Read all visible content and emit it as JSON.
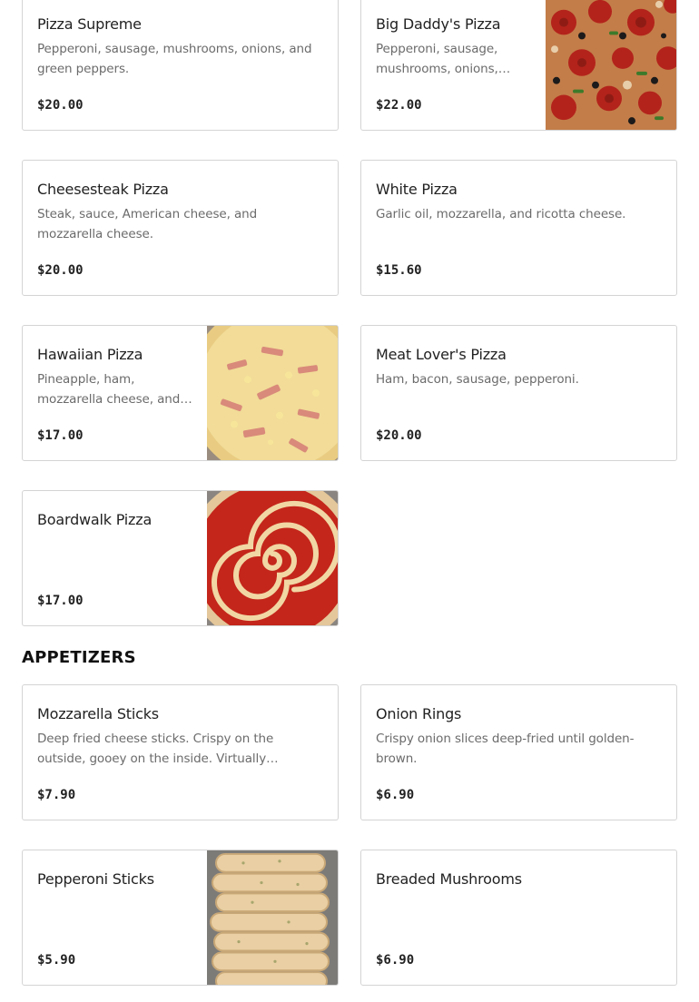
{
  "pizza_items": [
    {
      "name": "Pizza Supreme",
      "description": "Pepperoni, sausage, mushrooms, onions, and green peppers.",
      "price": "$20.00",
      "image": null
    },
    {
      "name": "Big Daddy's Pizza",
      "description": "Pepperoni, sausage, mushrooms, onions, green peppers, black olives, and ham.",
      "price": "$22.00",
      "image": "big-daddys-pizza-photo"
    },
    {
      "name": "Cheesesteak Pizza",
      "description": "Steak, sauce, American cheese, and mozzarella cheese.",
      "price": "$20.00",
      "image": null
    },
    {
      "name": "White Pizza",
      "description": "Garlic oil, mozzarella, and ricotta cheese.",
      "price": "$15.60",
      "image": null
    },
    {
      "name": "Hawaiian Pizza",
      "description": "Pineapple, ham, mozzarella cheese, and sauce.",
      "price": "$17.00",
      "image": "hawaiian-pizza-photo"
    },
    {
      "name": "Meat Lover's Pizza",
      "description": "Ham, bacon, sausage, pepperoni.",
      "price": "$20.00",
      "image": null
    },
    {
      "name": "Boardwalk Pizza",
      "description": "",
      "price": "$17.00",
      "image": "boardwalk-pizza-photo"
    }
  ],
  "appetizers": {
    "title": "APPETIZERS",
    "items": [
      {
        "name": "Mozzarella Sticks",
        "description": "Deep fried cheese sticks. Crispy on the outside, gooey on the inside. Virtually guaranteed to be a hit.",
        "price": "$7.90",
        "image": null
      },
      {
        "name": "Onion Rings",
        "description": "Crispy onion slices deep-fried until golden-brown.",
        "price": "$6.90",
        "image": null
      },
      {
        "name": "Pepperoni Sticks",
        "description": "",
        "price": "$5.90",
        "image": "pepperoni-sticks-photo"
      },
      {
        "name": "Breaded Mushrooms",
        "description": "",
        "price": "$6.90",
        "image": null
      }
    ]
  }
}
